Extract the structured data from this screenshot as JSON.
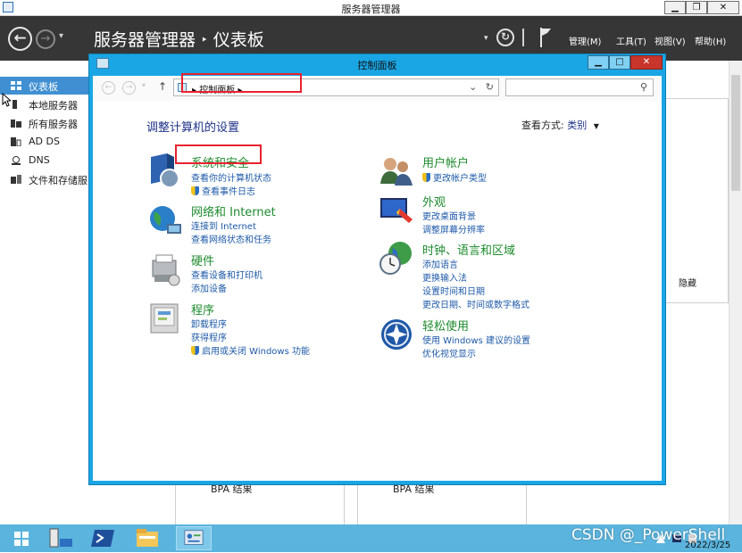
{
  "server_manager": {
    "window_title": "服务器管理器",
    "window_controls": {
      "minimize": "▁",
      "maximize": "❐",
      "close": "✕"
    },
    "breadcrumb": {
      "root": "服务器管理器",
      "separator": "‣",
      "current": "仪表板"
    },
    "menu": [
      "管理(M)",
      "工具(T)",
      "视图(V)",
      "帮助(H)"
    ],
    "sidebar": [
      {
        "label": "仪表板",
        "icon": "dashboard-icon",
        "active": true
      },
      {
        "label": "本地服务器",
        "icon": "server-icon",
        "active": false
      },
      {
        "label": "所有服务器",
        "icon": "servers-icon",
        "active": false
      },
      {
        "label": "AD DS",
        "icon": "ad-ds-icon",
        "active": false
      },
      {
        "label": "DNS",
        "icon": "dns-icon",
        "active": false
      },
      {
        "label": "文件和存储服",
        "icon": "file-storage-icon",
        "active": false
      }
    ],
    "hide_label": "隐藏",
    "bpa_labels": [
      "BPA 结果",
      "BPA 结果"
    ]
  },
  "control_panel": {
    "title": "控制面板",
    "window_controls": {
      "minimize": "▁",
      "maximize": "□",
      "close": "✕"
    },
    "address": {
      "arrow": "▸",
      "location": "控制面板",
      "trailing_arrow": "▸",
      "dropdown": "⌄",
      "refresh": "↻"
    },
    "search_placeholder": "",
    "heading": "调整计算机的设置",
    "view_by": {
      "label": "查看方式:",
      "value": "类别",
      "arrow": "▼"
    },
    "categories_left": [
      {
        "title": "系统和安全",
        "icon": "system-security-icon",
        "links": [
          {
            "text": "查看你的计算机状态",
            "shield": false
          },
          {
            "text": "查看事件日志",
            "shield": true
          }
        ]
      },
      {
        "title": "网络和 Internet",
        "icon": "network-internet-icon",
        "links": [
          {
            "text": "连接到 Internet",
            "shield": false
          },
          {
            "text": "查看网络状态和任务",
            "shield": false
          }
        ]
      },
      {
        "title": "硬件",
        "icon": "hardware-icon",
        "links": [
          {
            "text": "查看设备和打印机",
            "shield": false
          },
          {
            "text": "添加设备",
            "shield": false
          }
        ]
      },
      {
        "title": "程序",
        "icon": "programs-icon",
        "links": [
          {
            "text": "卸载程序",
            "shield": false
          },
          {
            "text": "获得程序",
            "shield": false
          },
          {
            "text": "启用或关闭 Windows 功能",
            "shield": true
          }
        ]
      }
    ],
    "categories_right": [
      {
        "title": "用户帐户",
        "icon": "user-accounts-icon",
        "links": [
          {
            "text": "更改帐户类型",
            "shield": true
          }
        ]
      },
      {
        "title": "外观",
        "icon": "appearance-icon",
        "links": [
          {
            "text": "更改桌面背景",
            "shield": false
          },
          {
            "text": "调整屏幕分辨率",
            "shield": false
          }
        ]
      },
      {
        "title": "时钟、语言和区域",
        "icon": "clock-language-region-icon",
        "links": [
          {
            "text": "添加语言",
            "shield": false
          },
          {
            "text": "更换输入法",
            "shield": false
          },
          {
            "text": "设置时间和日期",
            "shield": false
          },
          {
            "text": "更改日期、时间或数字格式",
            "shield": false
          }
        ]
      },
      {
        "title": "轻松使用",
        "icon": "ease-of-access-icon",
        "links": [
          {
            "text": "使用 Windows 建议的设置",
            "shield": false
          },
          {
            "text": "优化视觉显示",
            "shield": false
          }
        ]
      }
    ]
  },
  "taskbar": {
    "items": [
      "start-icon",
      "server-manager-icon",
      "powershell-icon",
      "file-explorer-icon",
      "control-panel-icon"
    ],
    "watermark": "CSDN @_PowerShell",
    "date": "2022/3/25"
  },
  "colors": {
    "header_bg": "#363636",
    "sidebar_active": "#3f8fd2",
    "cp_frame": "#1aa6e4",
    "category_title": "#1d8b2d",
    "link": "#1e5aa8",
    "highlight": "#e8222f",
    "taskbar": "#5ab4dd"
  }
}
